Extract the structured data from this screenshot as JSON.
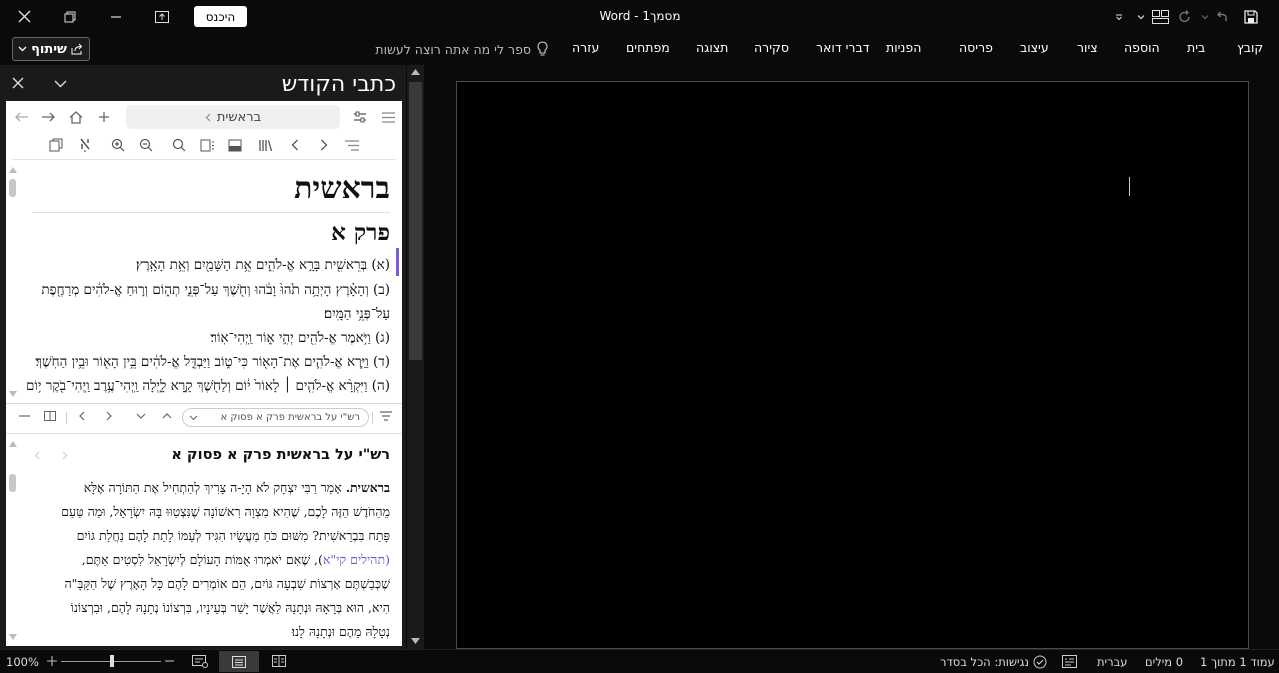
{
  "titlebar": {
    "title": "מסמך1 - Word",
    "signin_label": "היכנס"
  },
  "ribbon": {
    "share_label": "שיתוף",
    "tell_me_placeholder": "ספר לי מה אתה רוצה לעשות",
    "tabs": [
      "קובץ",
      "בית",
      "הוספה",
      "ציור",
      "עיצוב",
      "פריסה",
      "הפניות",
      "דברי דואר",
      "סקירה",
      "תצוגה",
      "מפתחים",
      "עזרה"
    ]
  },
  "pane": {
    "title": "כתבי הקודש",
    "breadcrumb": "בראשית",
    "book_title": "בראשית",
    "chapter_title": "פרק א",
    "verses": [
      "(א) בְּרֵאשִׁ֖ית בָּרָ֣א אֱ-לֹהִ֑ים אֵ֥ת הַשָּׁמַ֖יִם וְאֵ֥ת הָאָֽרֶץ׃",
      "(ב) וְהָאָ֗רֶץ הָיְתָ֥ה תֹ֙הוּ֙ וָבֹ֔הוּ וְחֹ֖שֶׁךְ עַל־פְּנֵ֣י תְה֑וֹם וְר֣וּחַ אֱ-לֹהִ֔ים מְרַחֶ֖פֶת",
      "עַל־פְּנֵ֥י הַמָּֽיִם׃",
      "(ג) וַיֹּ֥אמֶר אֱ-לֹהִ֖ים יְהִ֣י א֑וֹר וַֽיְהִי־אֽוֹר׃",
      "(ד) וַיַּ֧רְא אֱ-לֹהִ֛ים אֶת־הָא֖וֹר כִּי־ט֑וֹב וַיַּבְדֵּ֣ל אֱ-לֹהִ֔ים בֵּ֥ין הָא֖וֹר וּבֵ֥ין הַחֹֽשֶׁךְ׃",
      "(ה) וַיִּקְרָ֨א אֱ-לֹהִ֤ים ׀ לָאוֹר֙ י֔וֹם וְלַחֹ֖שֶׁךְ קָ֣רָא לָ֑יְלָה וַֽיְהִי־עֶ֥רֶב וַֽיְהִי־בֹ֖קֶר י֥וֹם"
    ],
    "commentary_search": "רש\"י על בראשית פרק א פסוק א",
    "commentary_title": "רש\"י על בראשית פרק א פסוק א",
    "commentary_lead": "בראשית.",
    "commentary_lines": [
      "אָמַר רַבִּי יִצְחָק לֹא הָיָ-ה צָרִיךְ לְהַתְחִיל אֶת הַתּוֹרָה אֶלָּא",
      "מֵהַחֹדֶשׁ הַזֶּה לָכֶם, שֶׁהִיא מִצְוָה רִאשׁוֹנָה שֶׁנִּצְטַוּוּ בָּהּ יִשְׂרָאֵל, וּמַה טַּעַם",
      "פָּתַח בִּבְרֵאשִׁית? מִשּׁוּם כֹּחַ מַעֲשָׂיו הִגִּיד לְעַמּוֹ לָתֵת לָהֶם נַחֲלַת גּוֹיִם",
      "), שֶׁאִם יֹאמְרוּ אֻמּוֹת הָעוֹלָם לְיִשְׂרָאֵל לִסְטִים אַתֶּם,",
      "שֶׁכְּבַשְׁתֶּם אַרְצוֹת שִׁבְעָה גּוֹיִם, הֵם אוֹמְרִים לָהֶם כָּל הָאָרֶץ שֶׁל הַקָּבָּ\"ה",
      "הִיא, הוּא בְּרָאָהּ וּנְתָנָהּ לַאֲשֶׁר יָשַׁר בְּעֵינָיו, בִּרְצוֹנוֹ נְתָנָהּ לָהֶם, וּבִרְצוֹנוֹ",
      "נְטָלָהּ מֵהֶם וּנְתָנָהּ לָנוּ׃"
    ],
    "commentary_link": "(תהילים קי\"א"
  },
  "status": {
    "page": "עמוד 1 מתוך 1",
    "words": "0 מילים",
    "language": "עברית",
    "accessibility": "נגישות: הכל בסדר",
    "zoom": "100%",
    "zoom_level": 0.5
  },
  "colors": {
    "accent": "#7b5cd6",
    "link": "#6a55c9",
    "background": "#0a0a0a"
  }
}
